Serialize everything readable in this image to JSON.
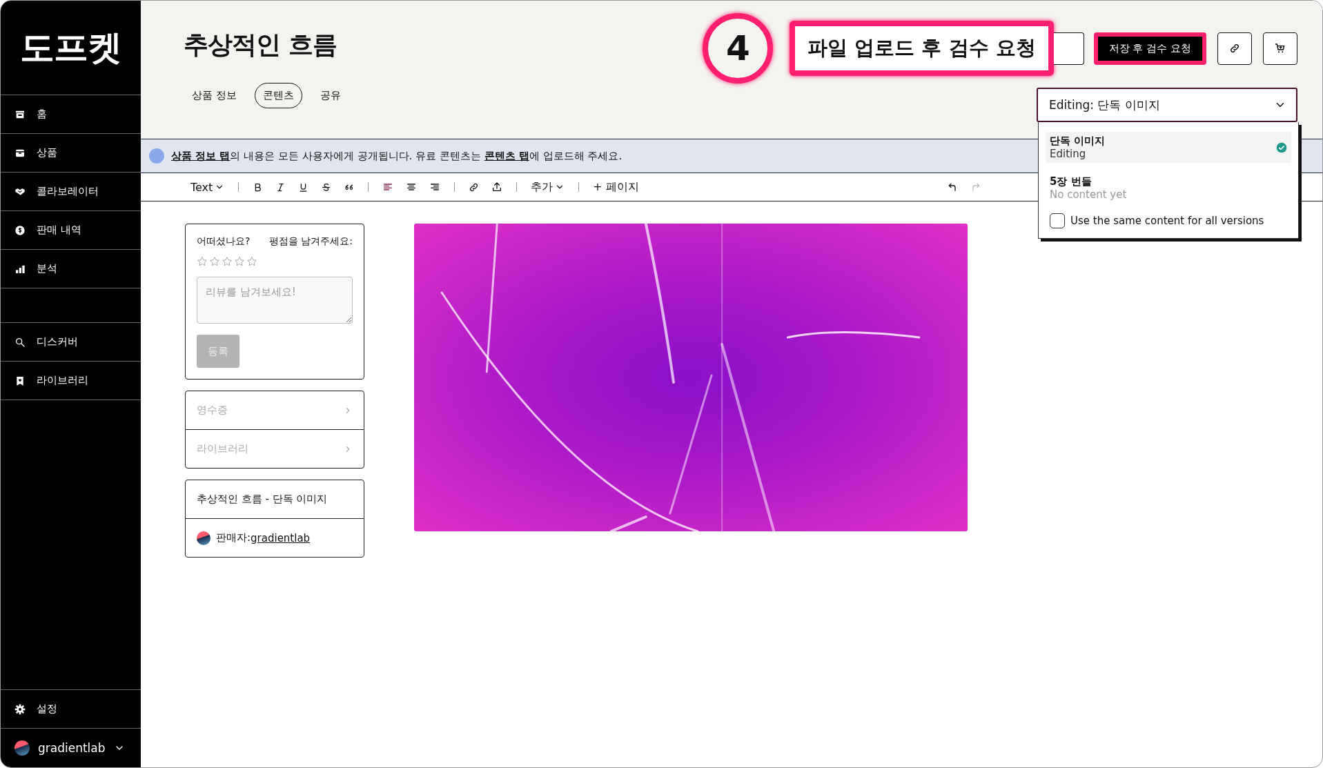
{
  "sidebar": {
    "logo": "도프켓",
    "nav_top": [
      {
        "label": "홈",
        "selected": false
      },
      {
        "label": "상품",
        "selected": false
      },
      {
        "label": "콜라보레이터",
        "selected": false
      },
      {
        "label": "판매 내역",
        "selected": false
      },
      {
        "label": "분석",
        "selected": false
      }
    ],
    "nav_bottom": [
      {
        "label": "디스커버",
        "selected": false
      },
      {
        "label": "라이브러리",
        "selected": false
      }
    ],
    "settings": "설정",
    "user": "gradientlab"
  },
  "header": {
    "title": "추상적인 흐름",
    "tabs": [
      {
        "label": "상품 정보",
        "selected": false
      },
      {
        "label": "콘텐츠",
        "selected": true
      },
      {
        "label": "공유",
        "selected": false
      }
    ],
    "save_button": "저장 후 검수 요청",
    "annotation": {
      "number": "4",
      "text": "파일 업로드 후 검수 요청"
    },
    "version_select": {
      "value": "Editing: 단독 이미지",
      "options": [
        {
          "title": "단독 이미지",
          "subtitle": "Editing",
          "selected": true
        },
        {
          "title": "5장 번들",
          "subtitle": "No content yet",
          "selected": false
        }
      ],
      "same_content": {
        "label": "Use the same content for all versions",
        "checked": false
      }
    }
  },
  "notice": "**상품 정보 탭**의 내용은 모든 사용자에게 공개됩니다. 유료 콘텐츠는 **콘텐츠 탭**에 업로드해 주세요.",
  "toolbar": {
    "text_style": "Text",
    "more": "추가",
    "add_page": "+ 페이지",
    "align": [
      {
        "selected": true
      },
      {
        "selected": false
      },
      {
        "selected": false
      }
    ],
    "undo": {
      "disabled": false
    },
    "redo": {
      "disabled": true
    }
  },
  "review": {
    "question": "어떠셨나요?",
    "rate_prompt": "평점을 남겨주세요:",
    "stars": 0,
    "placeholder": "리뷰를 남겨보세요!",
    "submit": "등록",
    "submit_disabled": true
  },
  "links": [
    {
      "label": "영수증"
    },
    {
      "label": "라이브러리"
    }
  ],
  "product": {
    "name": "추상적인 흐름 - 단독 이미지",
    "seller_label": "판매자: ",
    "seller": "gradientlab"
  }
}
